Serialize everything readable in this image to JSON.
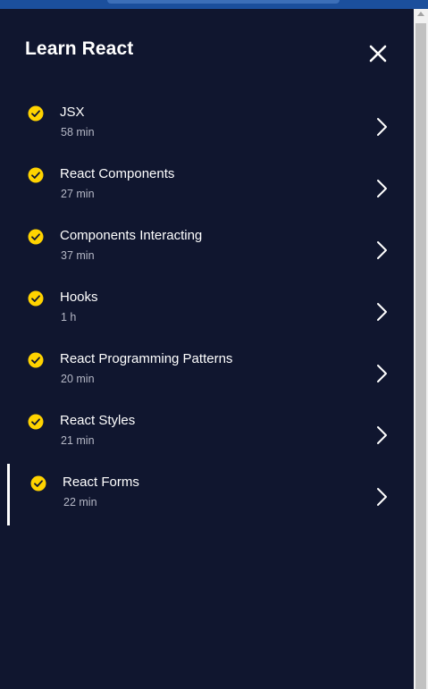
{
  "panel": {
    "title": "Learn React",
    "close_icon": "close-icon"
  },
  "lessons": [
    {
      "title": "JSX",
      "duration": "58 min",
      "completed": true,
      "active": false
    },
    {
      "title": "React Components",
      "duration": "27 min",
      "completed": true,
      "active": false
    },
    {
      "title": "Components Interacting",
      "duration": "37 min",
      "completed": true,
      "active": false
    },
    {
      "title": "Hooks",
      "duration": "1 h",
      "completed": true,
      "active": false
    },
    {
      "title": "React Programming Patterns",
      "duration": "20 min",
      "completed": true,
      "active": false
    },
    {
      "title": "React Styles",
      "duration": "21 min",
      "completed": true,
      "active": false
    },
    {
      "title": "React Forms",
      "duration": "22 min",
      "completed": true,
      "active": true
    }
  ],
  "icons": {
    "completed": "check-circle-icon",
    "open": "chevron-right-icon"
  },
  "colors": {
    "background": "#10162f",
    "check": "#ffd300",
    "text": "#ffffff",
    "subtext": "#b5b8c6"
  }
}
